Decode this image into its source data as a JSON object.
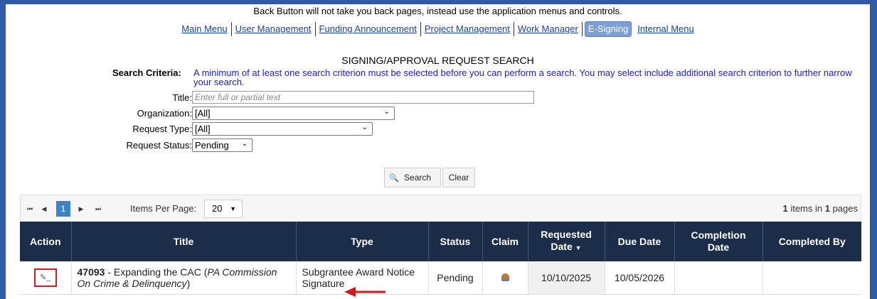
{
  "notice": "Back Button will not take you back pages, instead use the application menus and controls.",
  "nav": {
    "items": [
      "Main Menu",
      "User Management",
      "Funding Announcement",
      "Project Management",
      "Work Manager",
      "E-Signing",
      "Internal Menu"
    ],
    "active": "E-Signing"
  },
  "search": {
    "title": "SIGNING/APPROVAL REQUEST SEARCH",
    "criteria_label": "Search Criteria:",
    "criteria_text": "A minimum of at least one search criterion must be selected before you can perform a search. You may select include additional search criterion to further narrow your search.",
    "title_label": "Title:",
    "title_placeholder": "Enter full or partial text",
    "organization_label": "Organization:",
    "organization_value": "[All]",
    "request_type_label": "Request Type:",
    "request_type_value": "[All]",
    "request_status_label": "Request Status:",
    "request_status_value": "Pending",
    "search_button": "Search",
    "clear_button": "Clear"
  },
  "pager": {
    "current_page": "1",
    "items_per_page_label": "Items Per Page:",
    "items_per_page": "20",
    "count_items": "1",
    "count_mid": " items in ",
    "count_pages": "1",
    "count_suffix": " pages"
  },
  "grid": {
    "headers": {
      "action": "Action",
      "title": "Title",
      "type": "Type",
      "status": "Status",
      "claim": "Claim",
      "requested_date": "Requested Date",
      "due_date": "Due Date",
      "completion_date": "Completion Date",
      "completed_by": "Completed By"
    },
    "rows": [
      {
        "id": "47093",
        "title_text": " - Expanding the CAC (",
        "org": "PA Commission On Crime & Delinquency",
        "title_end": ")",
        "type": "Subgrantee Award Notice Signature",
        "status": "Pending",
        "claim_icon": "claim-person-icon",
        "requested_date": "10/10/2025",
        "due_date": "10/05/2026",
        "completion_date": "",
        "completed_by": ""
      }
    ]
  },
  "colors": {
    "background": "#2f5aa6",
    "header": "#1b2d48",
    "link": "#1a3fa0",
    "criteria_text": "#1a1ad8",
    "highlight": "#d31a1a"
  }
}
